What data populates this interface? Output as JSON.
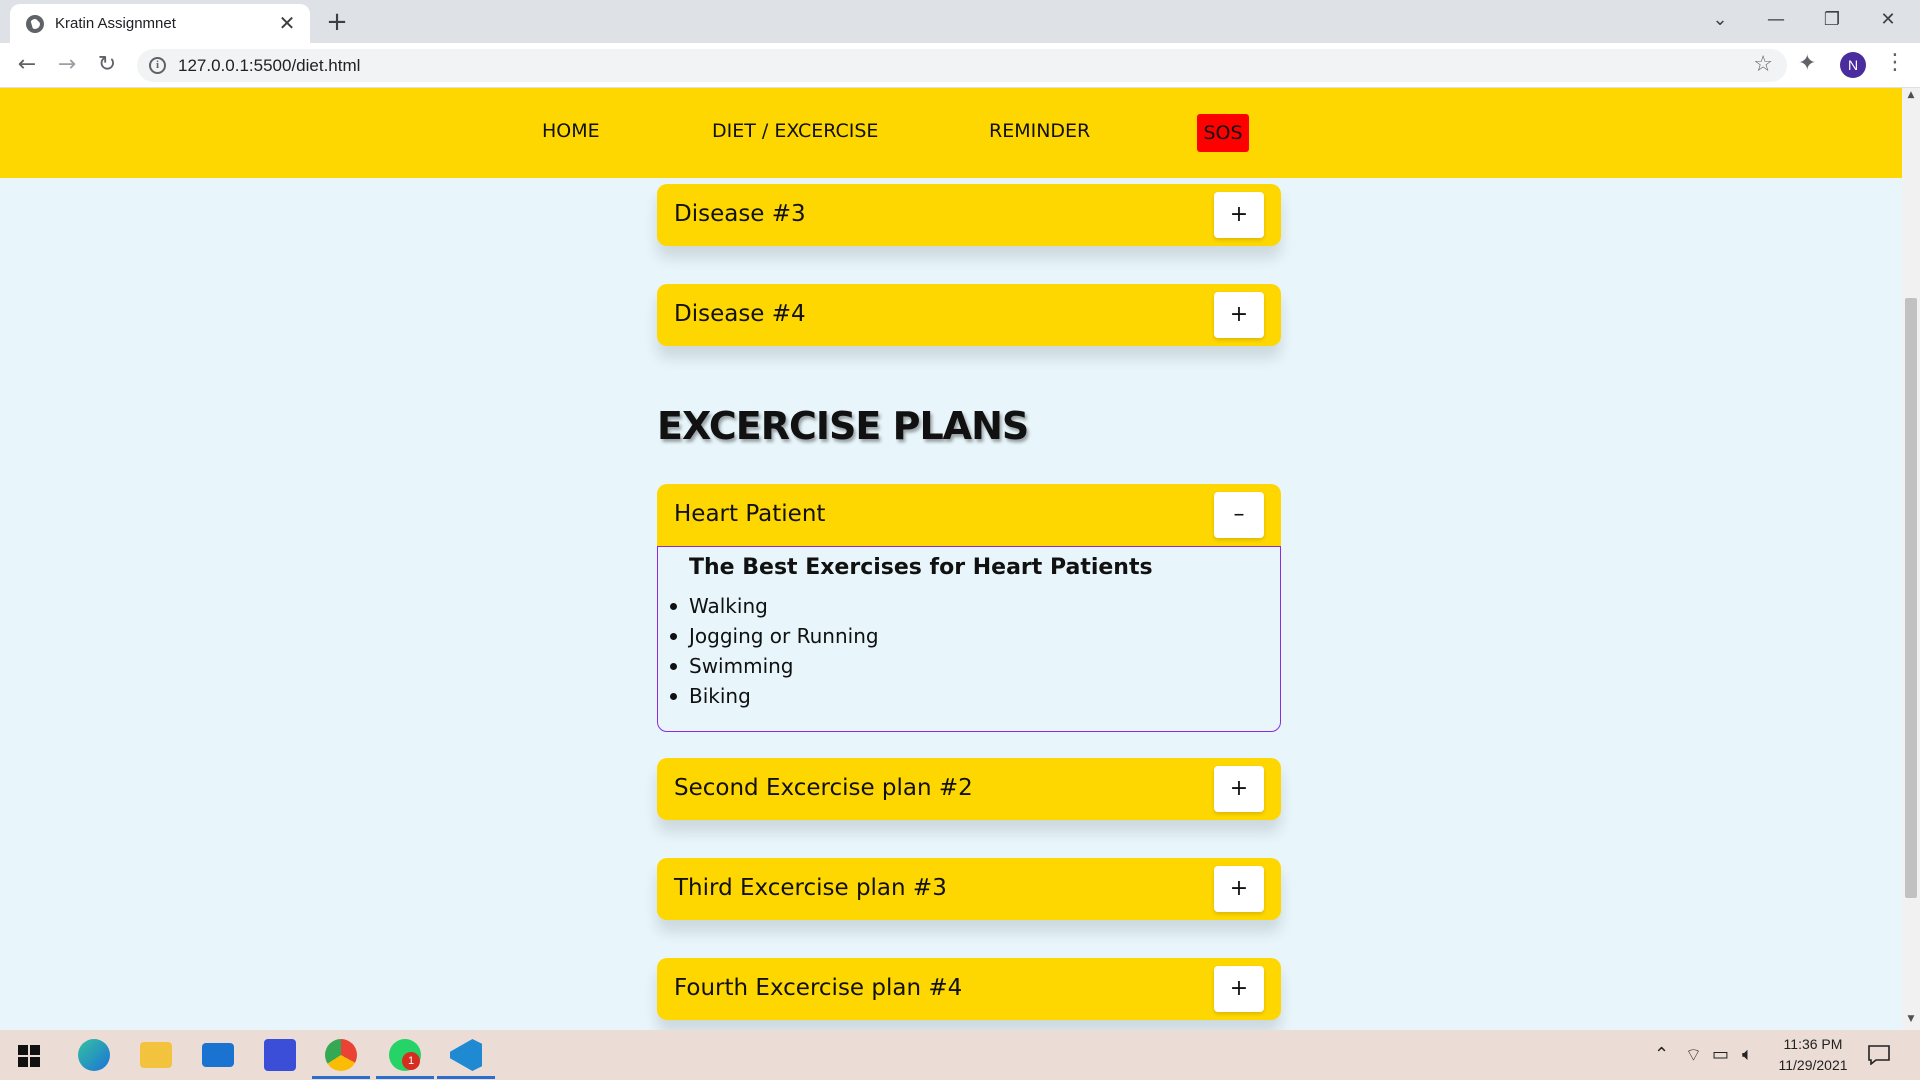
{
  "browser": {
    "tab_title": "Kratin Assignmnet",
    "tab_close": "✕",
    "new_tab": "+",
    "url": "127.0.0.1:5500/diet.html",
    "controls": {
      "dropdown": "⌄",
      "minimize": "—",
      "restore": "❐",
      "close": "✕"
    },
    "back": "←",
    "forward": "→",
    "reload": "↻",
    "info": "i",
    "profile_initial": "N"
  },
  "site_nav": {
    "home": "HOME",
    "diet": "DIET / EXCERCISE",
    "reminder": "REMINDER",
    "sos": "SOS"
  },
  "diseases": [
    {
      "label": "Disease #3",
      "toggle": "+"
    },
    {
      "label": "Disease #4",
      "toggle": "+"
    }
  ],
  "exercise": {
    "title": "EXCERCISE PLANS",
    "open_plan": {
      "label": "Heart Patient",
      "toggle": "–",
      "heading": "The Best Exercises for Heart Patients",
      "items": [
        "Walking",
        "Jogging or Running",
        "Swimming",
        "Biking"
      ]
    },
    "plans": [
      {
        "label": "Second Excercise plan #2",
        "toggle": "+"
      },
      {
        "label": "Third Excercise plan #3",
        "toggle": "+"
      },
      {
        "label": "Fourth Excercise plan #4",
        "toggle": "+"
      }
    ]
  },
  "taskbar": {
    "time": "11:36 PM",
    "date": "11/29/2021",
    "whatsapp_badge": "1"
  },
  "colors": {
    "nav_bg": "#ffd700",
    "page_bg": "#e8f6fb",
    "sos_bg": "#ff0000",
    "panel_border": "#8a2be2"
  }
}
